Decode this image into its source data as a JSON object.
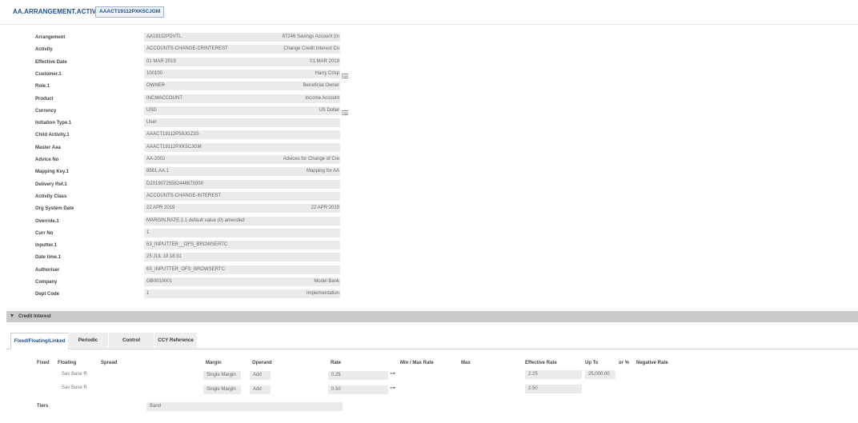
{
  "header": {
    "app_title": "AA.ARRANGEMENT.ACTIVITY",
    "record_id": "AAACT19112PXK5CJGM"
  },
  "fields": [
    {
      "label": "Arrangement",
      "value": "AA19112PDVTL",
      "enrichment": "87246 Savings Account (In"
    },
    {
      "label": "Activity",
      "value": "ACCOUNTS-CHANGE-CRINTEREST",
      "enrichment": "Change Credit Interest Co"
    },
    {
      "label": "Effective Date",
      "value": "01 MAR 2019",
      "enrichment": "01 MAR 2019"
    },
    {
      "label": "Customer.1",
      "value": "100100",
      "enrichment": "Harry Crisp"
    },
    {
      "label": "Role.1",
      "value": "OWNER",
      "enrichment": "Beneficial Owner"
    },
    {
      "label": "Product",
      "value": "INCMACCOUNT",
      "enrichment": "Income Account"
    },
    {
      "label": "Currency",
      "value": "USD",
      "enrichment": "US Dollar"
    },
    {
      "label": "Initiation Type.1",
      "value": "User",
      "enrichment": ""
    },
    {
      "label": "Child Activity.1",
      "value": "AAACT19112P58JGZ3S",
      "enrichment": ""
    },
    {
      "label": "Master Aaa",
      "value": "AAACT19112PXK5CJGM",
      "enrichment": ""
    },
    {
      "label": "Advice No",
      "value": "AA-2002",
      "enrichment": "Advices for Change of Cre"
    },
    {
      "label": "Mapping Key.1",
      "value": "8581.AA.1",
      "enrichment": "Mapping for AA"
    },
    {
      "label": "Delivery Ref.1",
      "value": "D20190725582446670300",
      "enrichment": ""
    },
    {
      "label": "Activity Class",
      "value": "ACCOUNTS-CHANGE-INTEREST",
      "enrichment": ""
    },
    {
      "label": "Org System Date",
      "value": "22 APR 2019",
      "enrichment": "22 APR 2019"
    },
    {
      "label": "Override.1",
      "value": "MARGIN.RATE.1.1 default value (0) amended",
      "enrichment": ""
    },
    {
      "label": "Curr No",
      "value": "1",
      "enrichment": ""
    },
    {
      "label": "Inputter.1",
      "value": "63_INPUTTER__OFS_BROWSERTC",
      "enrichment": ""
    },
    {
      "label": "Date time.1",
      "value": "25 JUL 19 18:31",
      "enrichment": ""
    },
    {
      "label": "Authoriser",
      "value": "63_INPUTTER_OFS_BROWSERTC",
      "enrichment": ""
    },
    {
      "label": "Company",
      "value": "GB0010001",
      "enrichment": "Model Bank"
    },
    {
      "label": "Dept Code",
      "value": "1",
      "enrichment": "Implementation"
    }
  ],
  "list_icons": [
    "list-icon",
    "list-icon"
  ],
  "section": {
    "title": "Credit Interest"
  },
  "tabs": [
    {
      "label": "Fixed/Floating/Linked",
      "active": true
    },
    {
      "label": "Periodic",
      "active": false
    },
    {
      "label": "Control",
      "active": false
    },
    {
      "label": "CCY Reference",
      "active": false
    }
  ],
  "interest_headers": {
    "fixed": "Fixed",
    "floating": "Floating",
    "spread": "Spread",
    "margin": "Margin",
    "operand": "Operand",
    "rate": "Rate",
    "min_max_rate": "Min / Max Rate",
    "max": "Max",
    "effective_rate": "Effective Rate",
    "up_to": "Up To",
    "or_pct": "or %",
    "negative_rate": "Negative Rate"
  },
  "interest_rows": [
    {
      "floating": "Sav Base R",
      "margin": "Single Margin",
      "operand": "Add",
      "rate": "0.25",
      "effective_rate": "2.25",
      "up_to": "25,000.00"
    },
    {
      "floating": "Sav Base R",
      "margin": "Single Margin",
      "operand": "Add",
      "rate": "0.50",
      "effective_rate": "2.50",
      "up_to": ""
    }
  ],
  "tiers": {
    "label": "Tiers",
    "value": "Band"
  },
  "arrow_glyph": "⊶"
}
